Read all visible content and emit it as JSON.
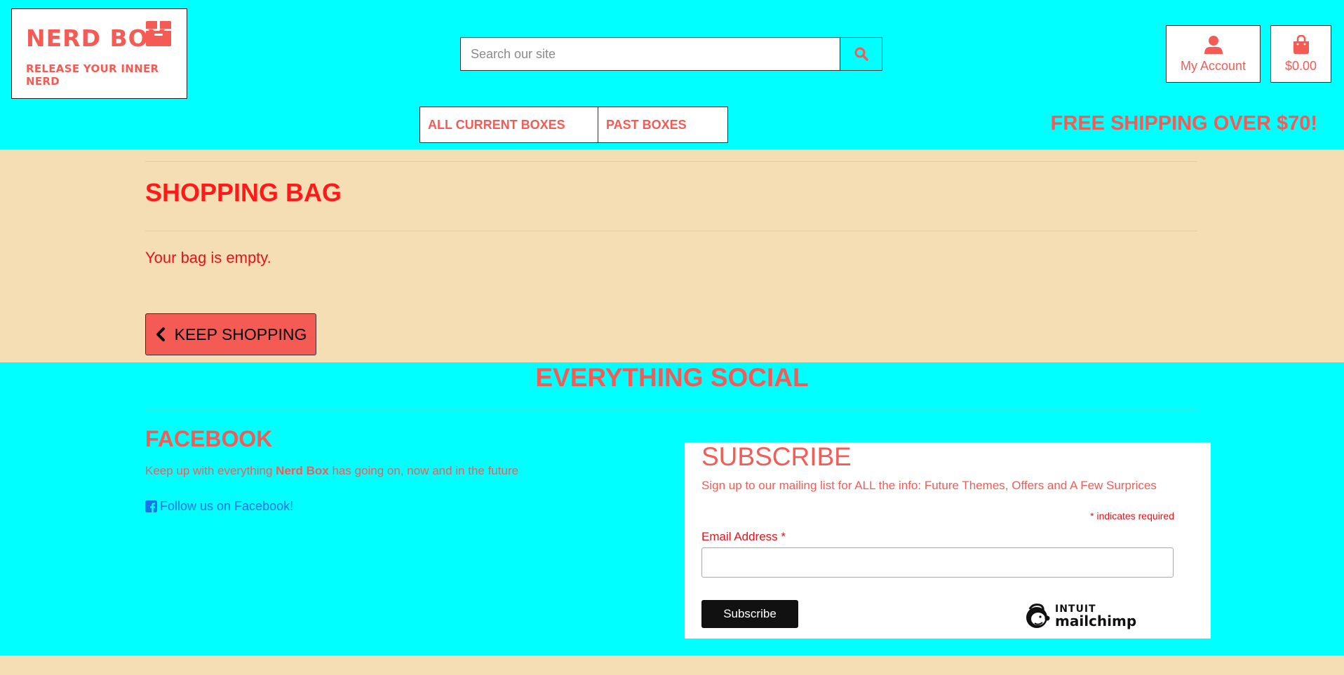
{
  "header": {
    "logo_title": "NERD BOX",
    "logo_tagline": "RELEASE YOUR INNER NERD",
    "search_placeholder": "Search our site",
    "account_label": "My Account",
    "bag_total": "$0.00",
    "nav": [
      {
        "label": "ALL CURRENT BOXES"
      },
      {
        "label": "PAST BOXES"
      }
    ],
    "promo": "FREE SHIPPING OVER $70!"
  },
  "bag": {
    "title": "SHOPPING BAG",
    "empty_message": "Your bag is empty.",
    "keep_shopping": "KEEP SHOPPING"
  },
  "social": {
    "title": "EVERYTHING SOCIAL",
    "facebook": {
      "title": "FACEBOOK",
      "text_before": "Keep up with everything ",
      "text_bold": "Nerd Box",
      "text_after": " has going on, now and in the future",
      "link": "Follow us on Facebook!"
    },
    "subscribe": {
      "title": "SUBSCRIBE",
      "description": "Sign up to our mailing list for ALL the info: Future Themes, Offers and A Few Surprices",
      "required_note": "* indicates required",
      "email_label": "Email Address",
      "required_marker": "*",
      "button": "Subscribe",
      "badge_brand": "INTUIT",
      "badge_name": "mailchimp"
    }
  },
  "colors": {
    "header_bg": "#00ffff",
    "page_bg": "#f5deb3",
    "accent": "#f55b55",
    "heading_red": "#ff1a1a",
    "link_blue": "#1a73e8"
  },
  "icons": [
    "box-icon",
    "search-icon",
    "user-icon",
    "shopping-bag-icon",
    "chevron-left-icon",
    "facebook-icon",
    "mailchimp-icon"
  ]
}
